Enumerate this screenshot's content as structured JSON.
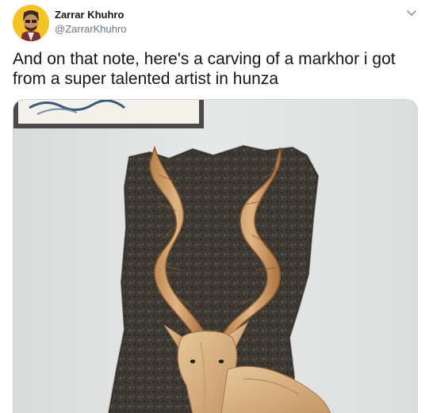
{
  "tweet": {
    "author_name": "Zarrar Khuhro",
    "author_handle": "@ZarrarKhuhro",
    "text": "And on that note, here's a carving of a markhor i got from a super talented artist in hunza"
  },
  "icons": {
    "menu": "chevron-down-icon",
    "avatar": "avatar-image"
  },
  "colors": {
    "avatar_bg": "#f5c327",
    "handle": "#657786",
    "text": "#14171a",
    "border": "#ccd6dd"
  }
}
